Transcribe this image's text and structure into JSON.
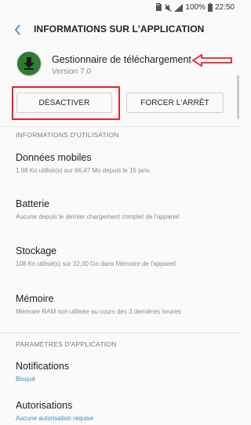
{
  "status_bar": {
    "battery": "100%",
    "time": "22:50"
  },
  "header": {
    "title": "INFORMATIONS SUR L'APPLICATION"
  },
  "app": {
    "name": "Gestionnaire de téléchargement",
    "version": "Version 7.0"
  },
  "actions": {
    "deactivate_label": "DÉSACTIVER",
    "force_stop_label": "FORCER L'ARRÊT"
  },
  "usage_section": {
    "header": "INFORMATIONS D'UTILISATION",
    "items": [
      {
        "title": "Données mobiles",
        "subtitle": "1,98 Ko utilisé(s) sur 66,47 Mo depuis le 15 janv."
      },
      {
        "title": "Batterie",
        "subtitle": "Aucune depuis le dernier chargement complet de l'appareil"
      },
      {
        "title": "Stockage",
        "subtitle": "108 Ko utilisé(s) sur 32,00 Go dans Mémoire de l'appareil"
      },
      {
        "title": "Mémoire",
        "subtitle": "Mémoire RAM non utilisée au cours des 3 dernières heures"
      }
    ]
  },
  "app_settings_section": {
    "header": "PARAMÈTRES D'APPLICATION",
    "items": [
      {
        "title": "Notifications",
        "subtitle": "Bloqué"
      },
      {
        "title": "Autorisations",
        "subtitle": "Aucune autorisation requise"
      }
    ]
  },
  "colors": {
    "accent": "#3a8ec4",
    "annotation": "#e0242b",
    "app_icon": "#2e7d32"
  },
  "icons": {
    "back": "chevron-left-icon",
    "app": "download-arrow-icon"
  }
}
